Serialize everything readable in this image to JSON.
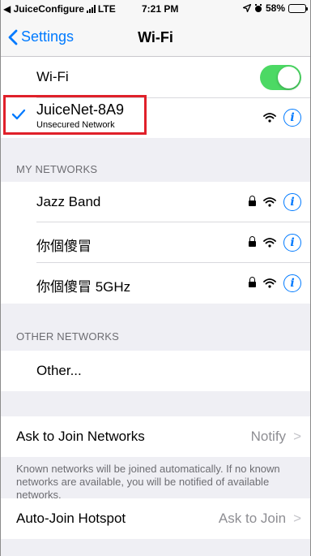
{
  "status_bar": {
    "carrier": "◀ JuiceConfigure",
    "network": "LTE",
    "time": "7:21 PM",
    "battery": "58%",
    "battery_level": 0.58
  },
  "nav": {
    "back_label": "Settings",
    "title": "Wi-Fi"
  },
  "wifi_toggle": {
    "label": "Wi-Fi",
    "on": true
  },
  "connected_network": {
    "name": "JuiceNet-8A9",
    "subtitle": "Unsecured Network"
  },
  "my_networks": {
    "header": "MY NETWORKS",
    "items": [
      {
        "name": "Jazz Band",
        "locked": true
      },
      {
        "name": "你個傻冒",
        "locked": true
      },
      {
        "name": "你個傻冒 5GHz",
        "locked": true
      }
    ]
  },
  "other_networks": {
    "header": "OTHER NETWORKS",
    "other_label": "Other..."
  },
  "ask_to_join": {
    "label": "Ask to Join Networks",
    "value": "Notify",
    "note": "Known networks will be joined automatically. If no known networks are available, you will be notified of available networks."
  },
  "auto_join_hotspot": {
    "label": "Auto-Join Hotspot",
    "value": "Ask to Join"
  },
  "colors": {
    "accent": "#007aff",
    "toggle_on": "#4cd964",
    "highlight_box": "#e0202a"
  }
}
